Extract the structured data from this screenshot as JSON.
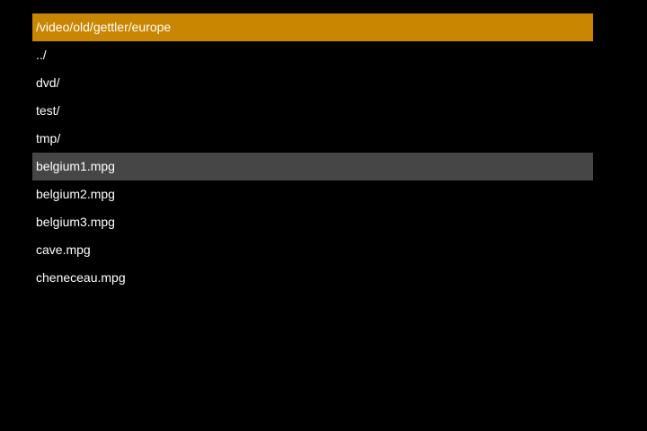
{
  "path_bar": {
    "current_path": "/video/old/gettler/europe"
  },
  "file_list": {
    "selected_index": 5,
    "items": [
      {
        "label": "../",
        "kind": "parent-directory"
      },
      {
        "label": "dvd/",
        "kind": "directory"
      },
      {
        "label": "test/",
        "kind": "directory"
      },
      {
        "label": "tmp/",
        "kind": "directory"
      },
      {
        "label": "belgium1.mpg",
        "kind": "video-file"
      },
      {
        "label": "belgium2.mpg",
        "kind": "video-file"
      },
      {
        "label": "belgium3.mpg",
        "kind": "video-file"
      },
      {
        "label": "cave.mpg",
        "kind": "video-file"
      },
      {
        "label": "cheneceau.mpg",
        "kind": "video-file"
      }
    ]
  },
  "colors": {
    "background": "#000000",
    "path_bar": "#c98600",
    "selection": "#464646",
    "text": "#ffffff"
  }
}
